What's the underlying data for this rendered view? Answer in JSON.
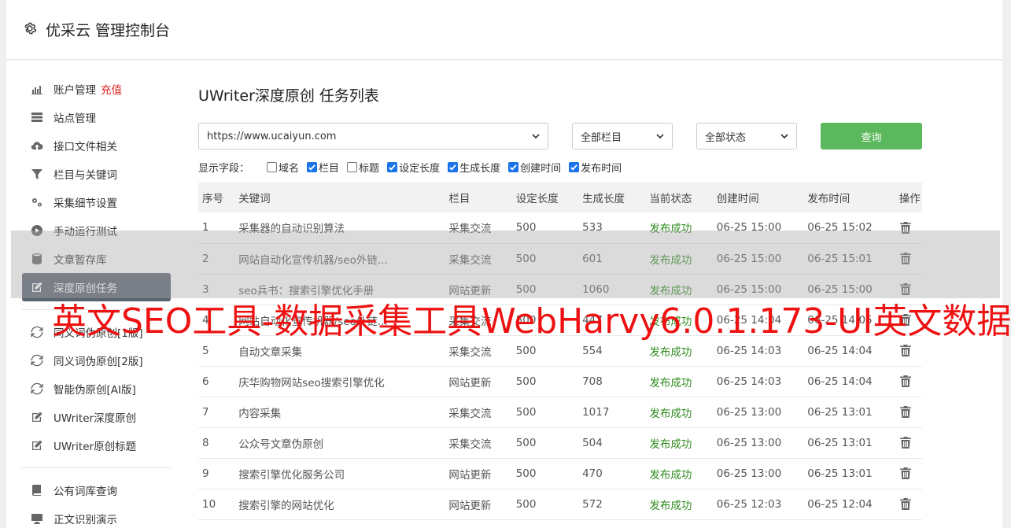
{
  "header": {
    "title": "优采云 管理控制台"
  },
  "sidebar": {
    "items": [
      {
        "label": "账户管理",
        "icon": "bar-chart-icon",
        "extra": "充值"
      },
      {
        "label": "站点管理",
        "icon": "server-icon"
      },
      {
        "label": "接口文件相关",
        "icon": "cloud-upload-icon"
      },
      {
        "label": "栏目与关键词",
        "icon": "filter-icon"
      },
      {
        "label": "采集细节设置",
        "icon": "cogs-icon"
      },
      {
        "label": "手动运行测试",
        "icon": "play-circle-icon"
      },
      {
        "label": "文章暂存库",
        "icon": "database-icon"
      },
      {
        "label": "深度原创任务",
        "icon": "edit-icon",
        "active": true
      },
      {
        "label": "同义词伪原创[1版]",
        "icon": "refresh-icon"
      },
      {
        "label": "同义词伪原创[2版]",
        "icon": "refresh-icon"
      },
      {
        "label": "智能伪原创[AI版]",
        "icon": "refresh-icon"
      },
      {
        "label": "UWriter深度原创",
        "icon": "edit-icon"
      },
      {
        "label": "UWriter原创标题",
        "icon": "edit-icon"
      },
      {
        "label": "公有词库查询",
        "icon": "book-icon"
      },
      {
        "label": "正文识别演示",
        "icon": "monitor-icon"
      }
    ]
  },
  "main": {
    "title": "UWriter深度原创 任务列表",
    "site_select": "https://www.ucaiyun.com",
    "column_select": "全部栏目",
    "status_select": "全部状态",
    "query_button": "查询",
    "fields_label": "显示字段：",
    "fields": [
      {
        "label": "域名",
        "checked": false
      },
      {
        "label": "栏目",
        "checked": true
      },
      {
        "label": "标题",
        "checked": false
      },
      {
        "label": "设定长度",
        "checked": true
      },
      {
        "label": "生成长度",
        "checked": true
      },
      {
        "label": "创建时间",
        "checked": true
      },
      {
        "label": "发布时间",
        "checked": true
      }
    ],
    "table": {
      "headers": [
        "序号",
        "关键词",
        "栏目",
        "设定长度",
        "生成长度",
        "当前状态",
        "创建时间",
        "发布时间",
        "操作"
      ],
      "rows": [
        [
          "1",
          "采集器的自动识别算法",
          "采集交流",
          "500",
          "533",
          "发布成功",
          "06-25 15:00",
          "06-25 15:02"
        ],
        [
          "2",
          "网站自动化宣传机器/seo外链...",
          "采集交流",
          "500",
          "601",
          "发布成功",
          "06-25 15:00",
          "06-25 15:01"
        ],
        [
          "3",
          "seo兵书：搜索引擎优化手册",
          "网站更新",
          "500",
          "1060",
          "发布成功",
          "06-25 15:00",
          "06-25 15:00"
        ],
        [
          "4",
          "网站自动化宣传机器/seo外链...",
          "采集交流",
          "500",
          "447",
          "发布成功",
          "06-25 14:04",
          "06-25 14:05"
        ],
        [
          "5",
          "自动文章采集",
          "采集交流",
          "500",
          "554",
          "发布成功",
          "06-25 14:03",
          "06-25 14:04"
        ],
        [
          "6",
          "庆华购物网站seo搜索引擎优化",
          "网站更新",
          "500",
          "708",
          "发布成功",
          "06-25 14:03",
          "06-25 14:04"
        ],
        [
          "7",
          "内容采集",
          "采集交流",
          "500",
          "1017",
          "发布成功",
          "06-25 13:00",
          "06-25 13:01"
        ],
        [
          "8",
          "公众号文章伪原创",
          "采集交流",
          "500",
          "504",
          "发布成功",
          "06-25 13:00",
          "06-25 13:01"
        ],
        [
          "9",
          "搜索引擎优化服务公司",
          "网站更新",
          "500",
          "470",
          "发布成功",
          "06-25 13:00",
          "06-25 13:01"
        ],
        [
          "10",
          "搜索引擎的网站优化",
          "网站更新",
          "500",
          "572",
          "发布成功",
          "06-25 12:03",
          "06-25 12:04"
        ]
      ]
    }
  },
  "overlay": {
    "watermark": "英文SEO工具-数据采集工具WebHarvy6.0.1.173-UI英文数据"
  },
  "colors": {
    "accent": "#5cb85c",
    "success": "#2e8b1e",
    "active_nav": "#5a6370",
    "watermark": "#ee1111"
  }
}
